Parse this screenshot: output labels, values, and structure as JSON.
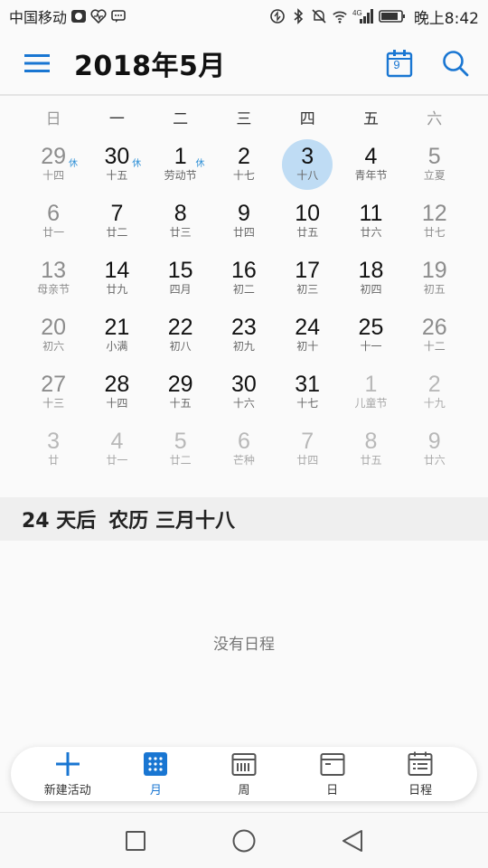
{
  "status_bar": {
    "carrier": "中国移动",
    "network": "4G",
    "time": "晚上8:42"
  },
  "header": {
    "title": "2018年5月",
    "today_day": "9"
  },
  "weekdays": [
    "日",
    "一",
    "二",
    "三",
    "四",
    "五",
    "六"
  ],
  "calendar": {
    "weeks": [
      [
        {
          "day": "29",
          "lunar": "十四",
          "badge": "休",
          "other": true
        },
        {
          "day": "30",
          "lunar": "十五",
          "badge": "休",
          "other": true
        },
        {
          "day": "1",
          "lunar": "劳动节",
          "badge": "休"
        },
        {
          "day": "2",
          "lunar": "十七"
        },
        {
          "day": "3",
          "lunar": "十八",
          "selected": true
        },
        {
          "day": "4",
          "lunar": "青年节"
        },
        {
          "day": "5",
          "lunar": "立夏"
        }
      ],
      [
        {
          "day": "6",
          "lunar": "廿一"
        },
        {
          "day": "7",
          "lunar": "廿二"
        },
        {
          "day": "8",
          "lunar": "廿三"
        },
        {
          "day": "9",
          "lunar": "廿四"
        },
        {
          "day": "10",
          "lunar": "廿五"
        },
        {
          "day": "11",
          "lunar": "廿六"
        },
        {
          "day": "12",
          "lunar": "廿七"
        }
      ],
      [
        {
          "day": "13",
          "lunar": "母亲节"
        },
        {
          "day": "14",
          "lunar": "廿九"
        },
        {
          "day": "15",
          "lunar": "四月"
        },
        {
          "day": "16",
          "lunar": "初二"
        },
        {
          "day": "17",
          "lunar": "初三"
        },
        {
          "day": "18",
          "lunar": "初四"
        },
        {
          "day": "19",
          "lunar": "初五"
        }
      ],
      [
        {
          "day": "20",
          "lunar": "初六"
        },
        {
          "day": "21",
          "lunar": "小满"
        },
        {
          "day": "22",
          "lunar": "初八"
        },
        {
          "day": "23",
          "lunar": "初九"
        },
        {
          "day": "24",
          "lunar": "初十"
        },
        {
          "day": "25",
          "lunar": "十一"
        },
        {
          "day": "26",
          "lunar": "十二"
        }
      ],
      [
        {
          "day": "27",
          "lunar": "十三"
        },
        {
          "day": "28",
          "lunar": "十四"
        },
        {
          "day": "29",
          "lunar": "十五"
        },
        {
          "day": "30",
          "lunar": "十六"
        },
        {
          "day": "31",
          "lunar": "十七"
        },
        {
          "day": "1",
          "lunar": "儿童节",
          "other": true
        },
        {
          "day": "2",
          "lunar": "十九",
          "other": true
        }
      ],
      [
        {
          "day": "3",
          "lunar": "廿",
          "other": true
        },
        {
          "day": "4",
          "lunar": "廿一",
          "other": true
        },
        {
          "day": "5",
          "lunar": "廿二",
          "other": true
        },
        {
          "day": "6",
          "lunar": "芒种",
          "other": true
        },
        {
          "day": "7",
          "lunar": "廿四",
          "other": true
        },
        {
          "day": "8",
          "lunar": "廿五",
          "other": true
        },
        {
          "day": "9",
          "lunar": "廿六",
          "other": true
        }
      ]
    ]
  },
  "info": {
    "days_until": "24 天后",
    "lunar_date": "农历 三月十八"
  },
  "empty_text": "没有日程",
  "tabs": [
    {
      "label": "新建活动",
      "icon": "plus-icon"
    },
    {
      "label": "月",
      "icon": "month-grid-icon",
      "active": true
    },
    {
      "label": "周",
      "icon": "week-view-icon"
    },
    {
      "label": "日",
      "icon": "day-view-icon"
    },
    {
      "label": "日程",
      "icon": "agenda-icon"
    }
  ],
  "colors": {
    "accent": "#1976d2",
    "selected_bg": "#bfdcf4",
    "badge": "#2d8fd6"
  }
}
